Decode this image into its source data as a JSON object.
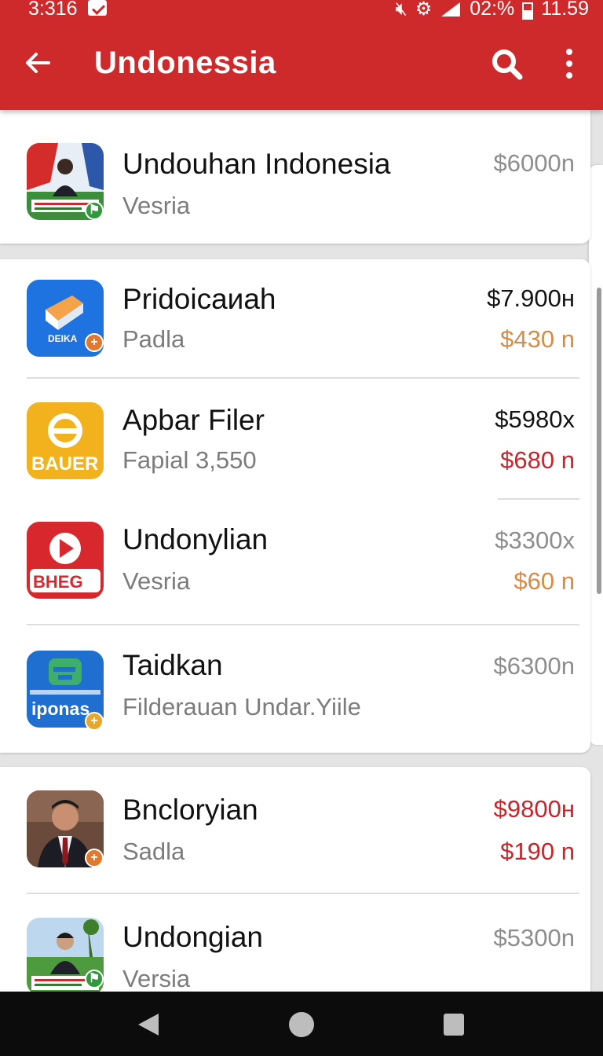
{
  "status_bar": {
    "time": "3:316",
    "battery_text": "02:%",
    "clock_right": "11.59"
  },
  "toolbar": {
    "title": "Undonessia",
    "icons": [
      "back-arrow-icon",
      "search-icon",
      "more-vert-icon"
    ]
  },
  "colors": {
    "app_bar": "#cf2a2b",
    "price_red": "#cc2329",
    "price_orange": "#d98a45"
  },
  "items": [
    {
      "name": "Undouhan Indonesia",
      "subtitle": "Vesria",
      "price": "$6000n",
      "price2": "",
      "icon": "flag-person-app-icon",
      "badge": "flag-badge-icon"
    },
    {
      "name": "Pridoicaиah",
      "subtitle": "Padla",
      "price": "$7.900н",
      "price2": "$430 n",
      "icon": "blue-box-app-icon",
      "badge": "add-badge-icon",
      "icon_text": "DEIKA"
    },
    {
      "name": "Apbar Filer",
      "subtitle": "Fapial 3,550",
      "price": "$5980x",
      "price2": "$680 n",
      "icon": "yellow-bauer-app-icon",
      "icon_text": "BAUER"
    },
    {
      "name": "Undonylian",
      "subtitle": "Vesria",
      "price": "$3300x",
      "price2": "$60 n",
      "icon": "red-play-app-icon",
      "icon_text": "BHEG"
    },
    {
      "name": "Taidkan",
      "subtitle": "Filderauan Undar.Yiile",
      "price": "$6300n",
      "price2": "",
      "icon": "blue-iponas-app-icon",
      "badge": "add-badge-icon",
      "icon_text": "iponas"
    },
    {
      "name": "Bncloryian",
      "subtitle": "Sadla",
      "price": "$9800н",
      "price2": "$190 n",
      "icon": "portrait-app-icon",
      "badge": "add-badge-icon"
    },
    {
      "name": "Undongian",
      "subtitle": "Versia",
      "price": "$5300n",
      "price2": "",
      "icon": "outdoor-person-app-icon",
      "badge": "flag-badge-icon"
    }
  ],
  "nav_bar": {
    "icons": [
      "nav-back-icon",
      "nav-home-icon",
      "nav-recents-icon"
    ]
  }
}
